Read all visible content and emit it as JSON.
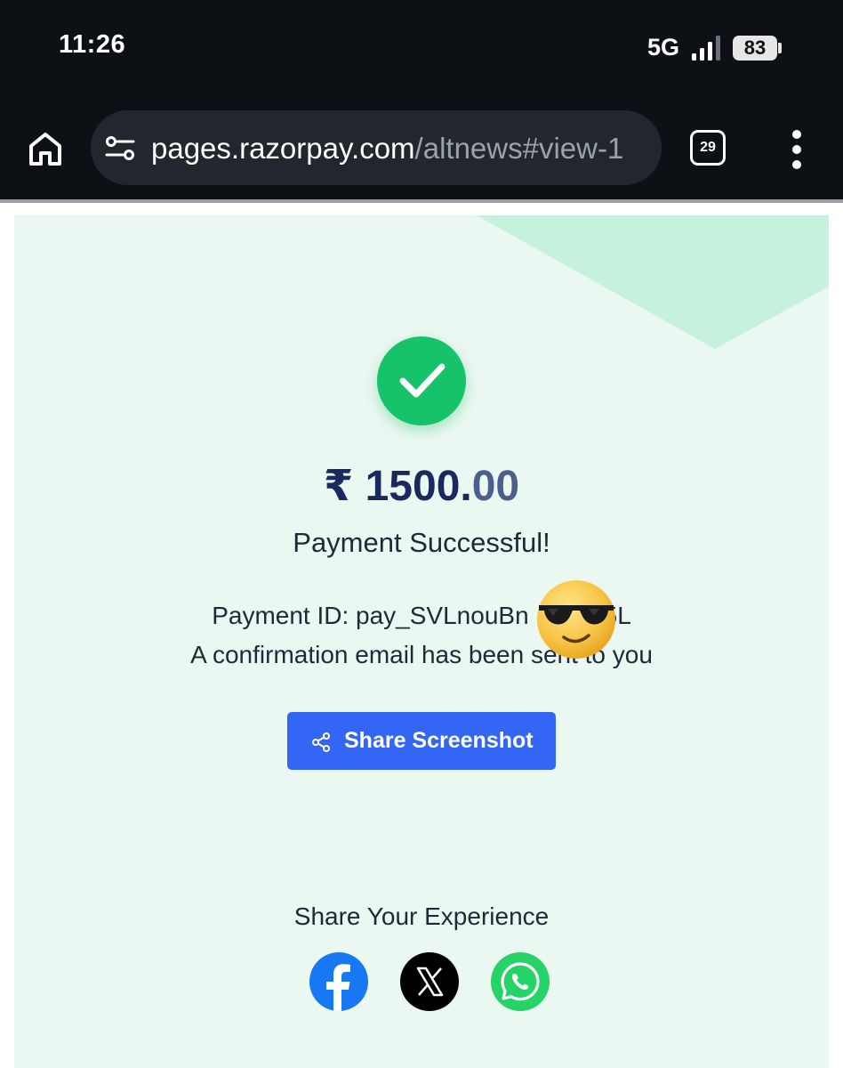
{
  "status_bar": {
    "time": "11:26",
    "network": "5G",
    "battery": "83"
  },
  "browser": {
    "url_host": "pages.razorpay.com",
    "url_path": "/altnews#view-1",
    "tab_count": "29"
  },
  "payment": {
    "currency_symbol": "₹",
    "amount_whole": "1500.",
    "amount_decimal": "00",
    "status": "Payment Successful!",
    "payment_id": "Payment ID: pay_SVLnouBn   5L",
    "confirmation": "A confirmation email has been sent to you",
    "share_button": "Share Screenshot"
  },
  "share_experience": {
    "title": "Share Your Experience",
    "networks": [
      "facebook-icon",
      "x-icon",
      "whatsapp-icon"
    ]
  },
  "colors": {
    "accent": "#3366f5",
    "success": "#16c26a",
    "amount": "#1b2a5e",
    "card_bg": "#ebf7f1"
  }
}
